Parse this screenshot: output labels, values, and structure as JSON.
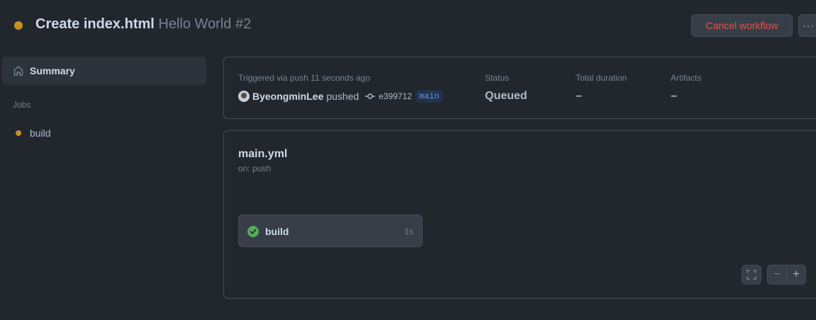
{
  "header": {
    "title": "Create index.html",
    "subtitle": "Hello World #2",
    "status_color": "#c69026",
    "cancel_label": "Cancel workflow",
    "more_label": "···"
  },
  "sidebar": {
    "summary_label": "Summary",
    "summary_icon": "home-icon",
    "jobs_heading": "Jobs",
    "jobs": [
      {
        "label": "build",
        "status_color": "#c69026"
      }
    ]
  },
  "summary": {
    "triggered_text": "Triggered via push 11 seconds ago",
    "actor": "ByeongminLee",
    "action": "pushed",
    "commit_sha": "e399712",
    "branch": "main",
    "status_label": "Status",
    "status_value": "Queued",
    "duration_label": "Total duration",
    "duration_value": "–",
    "artifacts_label": "Artifacts",
    "artifacts_value": "–"
  },
  "workflow": {
    "file": "main.yml",
    "trigger": "on: push",
    "jobs": [
      {
        "name": "build",
        "duration": "1s",
        "status": "success",
        "status_color": "#57ab5a"
      }
    ]
  },
  "graph_controls": {
    "fullscreen_icon": "fullscreen-icon",
    "zoom_out_label": "−",
    "zoom_in_label": "+"
  }
}
